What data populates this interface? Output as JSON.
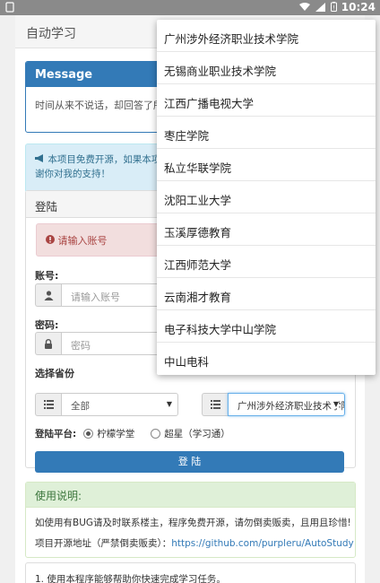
{
  "status_bar": {
    "time": "10:24"
  },
  "app": {
    "title": "自动学习"
  },
  "message_panel": {
    "heading": "Message",
    "body": "时间从来不说话，却回答了所有问题"
  },
  "info_alert": {
    "line1": "本项目免费开源，如果本项目对你有帮助，请给个star，谢",
    "line2": "谢你对我的支持！"
  },
  "login": {
    "heading": "登陆",
    "error": "请输入账号",
    "account_label": "账号:",
    "account_placeholder": "请输入账号",
    "password_label": "密码:",
    "password_placeholder": "密码",
    "province_label": "选择省份",
    "province_value": "全部",
    "school_value": "广州涉外经济职业技术学院",
    "platform_label": "登陆平台:",
    "platform_opt1": "柠檬学堂",
    "platform_opt2": "超星（学习通）",
    "button": "登 陆"
  },
  "usage": {
    "heading": "使用说明:",
    "line1": "如使用有BUG请及时联系楼主，程序免费开源，请勿倒卖贩卖，且用且珍惜!",
    "line2_prefix": "项目开源地址（严禁倒卖贩卖）：",
    "line2_link": "https://github.com/purpleru/AutoStudy"
  },
  "tip": "1. 使用本程序能够帮助你快速完成学习任务。",
  "dropdown": {
    "options": [
      "广州涉外经济职业技术学院",
      "无锡商业职业技术学院",
      "江西广播电视大学",
      "枣庄学院",
      "私立华联学院",
      "沈阳工业大学",
      "玉溪厚德教育",
      "江西师范大学",
      "云南湘才教育",
      "电子科技大学中山学院",
      "中山电科"
    ]
  }
}
